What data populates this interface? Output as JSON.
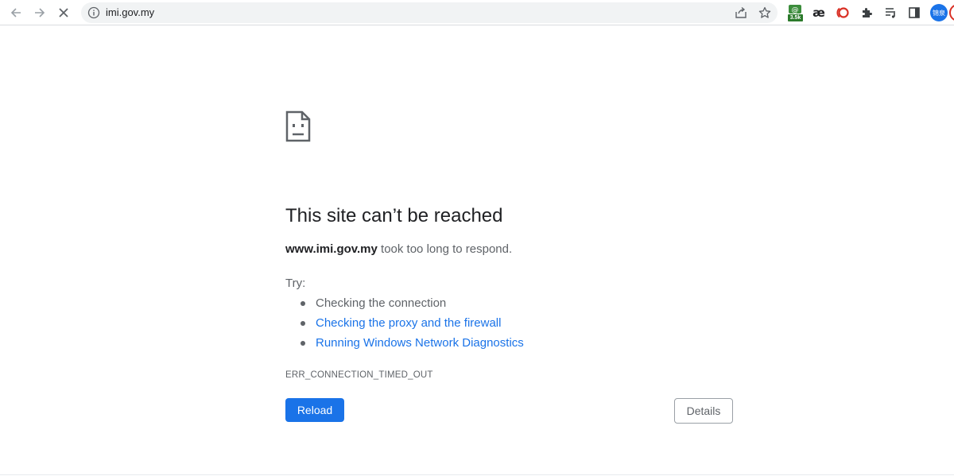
{
  "browser": {
    "url": "imi.gov.my",
    "extensions": [
      {
        "name": "money-extension-icon",
        "badge": "3.5k"
      },
      {
        "name": "ae-extension-icon",
        "glyph": "æ"
      },
      {
        "name": "red-ring-extension-icon"
      },
      {
        "name": "puzzle-icon"
      },
      {
        "name": "reading-list-icon"
      },
      {
        "name": "side-panel-icon"
      }
    ],
    "avatar_text": "锦泉"
  },
  "error_page": {
    "heading": "This site can’t be reached",
    "host": "www.imi.gov.my",
    "message": " took too long to respond.",
    "try_label": "Try:",
    "suggestions": [
      "Checking the connection",
      "Checking the proxy and the firewall",
      "Running Windows Network Diagnostics"
    ],
    "error_code": "ERR_CONNECTION_TIMED_OUT",
    "reload_label": "Reload",
    "details_label": "Details"
  },
  "colors": {
    "accent": "#1a73e8",
    "text_primary": "#202124",
    "text_secondary": "#5f6368"
  }
}
